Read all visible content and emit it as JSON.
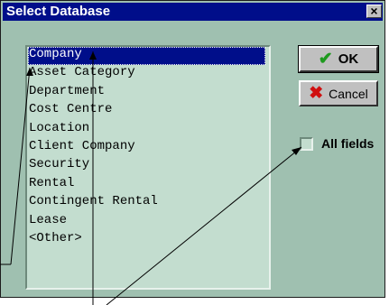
{
  "window": {
    "title": "Select Database",
    "close_glyph": "×"
  },
  "list": {
    "items": [
      "Company",
      "Asset Category",
      "Department",
      "Cost Centre",
      "Location",
      "Client Company",
      "Security",
      "Rental",
      "Contingent Rental",
      "Lease",
      "<Other>"
    ],
    "selected_index": 0
  },
  "buttons": {
    "ok_label": "OK",
    "ok_icon": "check-icon",
    "cancel_label": "Cancel",
    "cancel_icon": "x-icon"
  },
  "options": {
    "all_fields_label": "All fields",
    "all_fields_checked": false
  },
  "colors": {
    "dialog_bg": "#9fc0b0",
    "titlebar": "#000e8a",
    "listbox_bg": "#c3ddcf",
    "ok_check": "#1e9a1e",
    "cancel_x": "#d01010"
  }
}
